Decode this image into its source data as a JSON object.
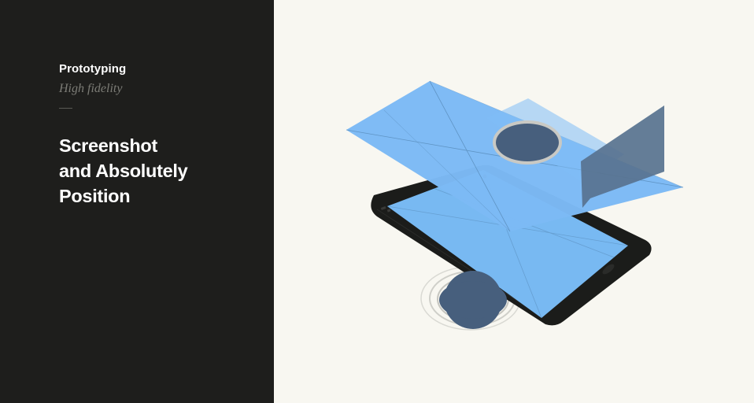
{
  "slide": {
    "kicker": "Prototyping",
    "subtitle": "High fidelity",
    "title_lines": [
      "Screenshot",
      "and Absolutely",
      "Position"
    ]
  },
  "colors": {
    "panel_background": "#1e1e1c",
    "canvas_background": "#f8f7f1",
    "screen_blue": "#78b9f2",
    "layer_blue": "#7cbaf5",
    "slate_blue": "#587390",
    "dark_circle": "#475f7d",
    "phone_body": "#1b1c1a",
    "ring_gray": "#c9c9c4"
  },
  "illustration": {
    "icons": [
      "phone-icon",
      "layer-icon",
      "button-icon",
      "tooltip-icon",
      "tap-icon"
    ]
  }
}
